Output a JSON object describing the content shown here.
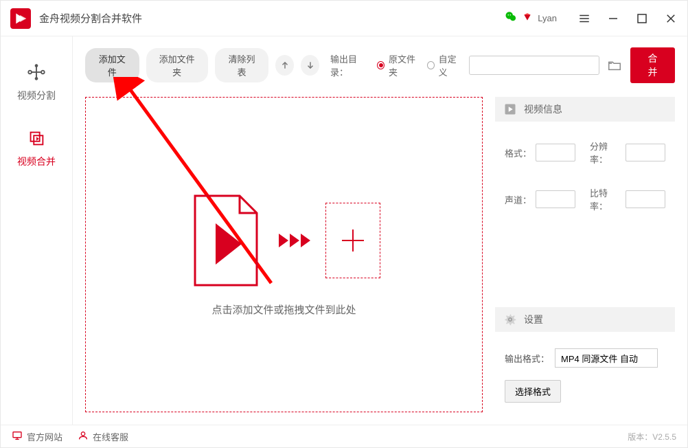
{
  "titlebar": {
    "app_title": "金舟视频分割合并软件",
    "user_name": "Lyan"
  },
  "sidebar": {
    "split_label": "视频分割",
    "merge_label": "视频合并"
  },
  "toolbar": {
    "add_file": "添加文件",
    "add_folder": "添加文件夹",
    "clear_list": "清除列表",
    "output_dir_label": "输出目录：",
    "radio_source": "原文件夹",
    "radio_custom": "自定义",
    "path_value": "",
    "merge_btn": "合并"
  },
  "dropzone": {
    "text": "点击添加文件或拖拽文件到此处"
  },
  "info_panel": {
    "header": "视频信息",
    "format_label": "格式：",
    "resolution_label": "分辨率：",
    "channels_label": "声道：",
    "bitrate_label": "比特率："
  },
  "settings_panel": {
    "header": "设置",
    "output_format_label": "输出格式：",
    "output_format_value": "MP4 同源文件 自动",
    "choose_format_btn": "选择格式"
  },
  "footer": {
    "official_site": "官方网站",
    "online_service": "在线客服",
    "version": "版本：V2.5.5"
  }
}
